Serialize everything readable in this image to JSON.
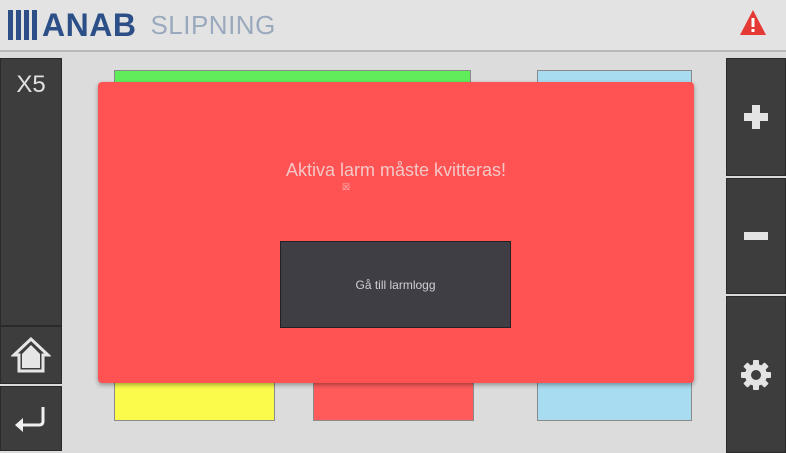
{
  "header": {
    "brand": "ANAB",
    "product": "SLIPNING",
    "alarm_icon": "warning-triangle-icon",
    "accent_color": "#2b4f86",
    "alarm_color": "#e53935"
  },
  "left_nav": {
    "multiplier_label": "X5",
    "home_icon": "home-icon",
    "back_icon": "return-arrow-icon"
  },
  "right_nav": {
    "plus_icon": "plus-icon",
    "minus_icon": "minus-icon",
    "settings_icon": "gear-icon"
  },
  "tiles": {
    "colors": [
      "#5fee5a",
      "#a8dcf0",
      "#fbfb4c",
      "#ff5b5b",
      "#a8dcf0"
    ]
  },
  "alarm_dialog": {
    "message": "Aktiva larm måste kvitteras!",
    "close_glyph": "☒",
    "button_label": "Gå till larmlogg",
    "background_color": "#ff5252"
  }
}
